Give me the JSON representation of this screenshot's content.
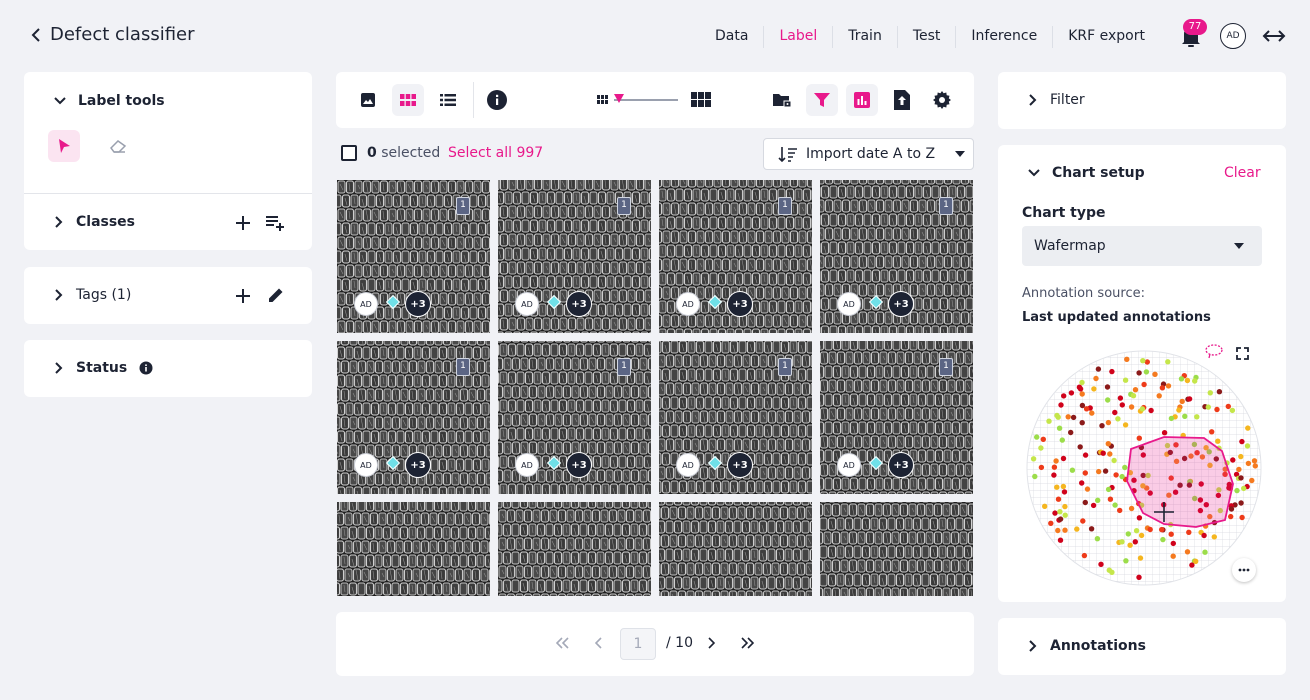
{
  "header": {
    "back_icon": "chevron-left-icon",
    "title": "Defect classifier",
    "nav": [
      {
        "label": "Data",
        "active": false
      },
      {
        "label": "Label",
        "active": true
      },
      {
        "label": "Train",
        "active": false
      },
      {
        "label": "Test",
        "active": false
      },
      {
        "label": "Inference",
        "active": false
      },
      {
        "label": "KRF export",
        "active": false
      }
    ],
    "notification_count": "77",
    "avatar": "AD"
  },
  "left_panel": {
    "label_tools": "Label tools",
    "classes": "Classes",
    "tags": "Tags (1)",
    "status": "Status"
  },
  "toolbar": {
    "selected_count": "0",
    "selected_label": "selected",
    "select_all": "Select all 997",
    "sort_label": "Import date A to Z"
  },
  "grid": {
    "tiles": [
      {
        "flag": "1",
        "avatar": "AD",
        "more": "+3"
      },
      {
        "flag": "1",
        "avatar": "AD",
        "more": "+3"
      },
      {
        "flag": "1",
        "avatar": "AD",
        "more": "+3"
      },
      {
        "flag": "1",
        "avatar": "AD",
        "more": "+3"
      },
      {
        "flag": "1",
        "avatar": "AD",
        "more": "+3"
      },
      {
        "flag": "1",
        "avatar": "AD",
        "more": "+3"
      },
      {
        "flag": "1",
        "avatar": "AD",
        "more": "+3"
      },
      {
        "flag": "1",
        "avatar": "AD",
        "more": "+3"
      }
    ]
  },
  "pagination": {
    "current": "1",
    "total": "/ 10"
  },
  "right_panel": {
    "filter": "Filter",
    "chart_setup": "Chart setup",
    "clear": "Clear",
    "chart_type_label": "Chart type",
    "chart_type_value": "Wafermap",
    "annotation_source_label": "Annotation source:",
    "annotation_source_value": "Last updated annotations",
    "annotations": "Annotations"
  },
  "colors": {
    "accent": "#e8198b",
    "dark": "#1d2333",
    "wafer_colors": [
      "#d0021b",
      "#ee3b1a",
      "#f57a1f",
      "#f5b61f",
      "#c5e64a",
      "#9cdd4a",
      "#8b1a1a"
    ]
  }
}
